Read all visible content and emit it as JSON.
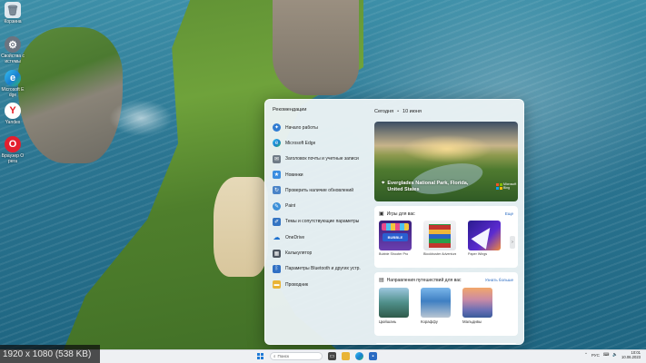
{
  "desktop": {
    "icons": [
      {
        "label": "Корзина",
        "icon": "recycle-bin-icon",
        "color": "#dfe8ef"
      },
      {
        "label": "Свойства системы",
        "icon": "system-properties-icon",
        "color": "#6b7480"
      },
      {
        "label": "Microsoft Edge",
        "icon": "edge-icon",
        "color": "#1a9bd7"
      },
      {
        "label": "Yandex",
        "icon": "yandex-icon",
        "color": "#ffffff"
      },
      {
        "label": "Браузер Opera",
        "icon": "opera-icon",
        "color": "#e3202f"
      }
    ]
  },
  "start_menu": {
    "recommended_title": "Рекомендации",
    "recommended": [
      {
        "label": "Начало работы",
        "icon": "get-started-icon",
        "color": "#2f7bd1"
      },
      {
        "label": "Microsoft Edge",
        "icon": "edge-icon",
        "color": "#1a9bd7"
      },
      {
        "label": "Заголовок почты и учетные записи",
        "icon": "mail-icon",
        "color": "#6f7b86"
      },
      {
        "label": "Новинки",
        "icon": "new-icon",
        "color": "#3a8de0"
      },
      {
        "label": "Проверить наличие обновлений",
        "icon": "update-icon",
        "color": "#4a83c7"
      },
      {
        "label": "Paint",
        "icon": "paint-icon",
        "color": "#3b8fd8"
      },
      {
        "label": "Темы и сопутствующие параметры",
        "icon": "themes-icon",
        "color": "#3474c2"
      },
      {
        "label": "OneDrive",
        "icon": "onedrive-icon",
        "color": "#1b6fce"
      },
      {
        "label": "Калькулятор",
        "icon": "calculator-icon",
        "color": "#4c5560"
      },
      {
        "label": "Параметры Bluetooth и других устр.",
        "icon": "bluetooth-icon",
        "color": "#2f6fc4"
      },
      {
        "label": "Проводник",
        "icon": "file-explorer-icon",
        "color": "#e9b436"
      }
    ],
    "widgets": {
      "today_label": "Сегодня",
      "date_label": "10 июня",
      "hero_caption_line1": "Everglades National Park, Florida,",
      "hero_caption_line2": "United States",
      "hero_brand": "Microsoft Bing",
      "games_title": "Игры для вас",
      "games_link": "Еще",
      "games": [
        {
          "label": "Bubble Shooter Pro",
          "color": "#6a3fb0"
        },
        {
          "label": "Blockbuster Adventure Puzzle",
          "color": "#c2352e"
        },
        {
          "label": "Paper Wings",
          "color": "#3f2aa8"
        }
      ],
      "trips_title": "Направления путешествий для вас",
      "trips_link": "Узнать больше",
      "trips": [
        {
          "label": "Цюйшань",
          "color": "#4f8f8a"
        },
        {
          "label": "Кораффу",
          "color": "#3f7fc2"
        },
        {
          "label": "Мальдивы",
          "color": "#6a6fb5"
        }
      ]
    }
  },
  "taskbar": {
    "overlay_text": "1920 x 1080 (538 KB)",
    "search_placeholder": "Поиск",
    "tray_lang": "РУС",
    "clock_time": "10:01",
    "clock_date": "10.06.2023"
  },
  "colors": {
    "accent": "#2a6bc2",
    "start_bg": "#ebf3f5"
  }
}
